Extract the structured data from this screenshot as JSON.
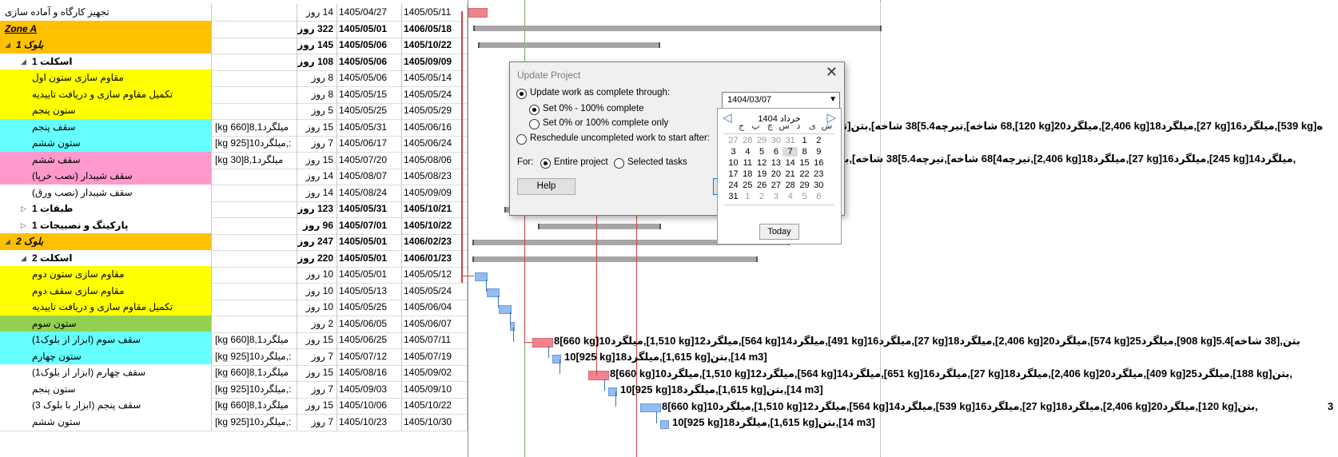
{
  "rows": [
    {
      "name": "تجهیز کارگاه و آماده سازی",
      "res": "",
      "dur": "14 روز",
      "start": "1405/04/27",
      "finish": "1405/05/11",
      "bg": "#ffffff",
      "bold": false,
      "italic": false,
      "indent": 0,
      "tri": ""
    },
    {
      "name": "Zone A",
      "res": "",
      "dur": "322 روز",
      "start": "1405/05/01",
      "finish": "1406/05/18",
      "bg": "#ffc000",
      "bold": true,
      "italic": true,
      "indent": 0,
      "tri": "",
      "ltr": true
    },
    {
      "name": "بلوک 1",
      "res": "",
      "dur": "145 روز",
      "start": "1405/05/06",
      "finish": "1405/10/22",
      "bg": "#ffc000",
      "bold": true,
      "italic": true,
      "indent": 1,
      "tri": "◢"
    },
    {
      "name": "اسکلت 1",
      "res": "",
      "dur": "108 روز",
      "start": "1405/05/06",
      "finish": "1405/09/09",
      "bg": "#ffffff",
      "bold": true,
      "italic": false,
      "indent": 2,
      "tri": "◢"
    },
    {
      "name": "مقاوم سازی ستون اول",
      "res": "",
      "dur": "8 روز",
      "start": "1405/05/06",
      "finish": "1405/05/14",
      "bg": "#ffff00",
      "bold": false,
      "italic": false,
      "indent": 3,
      "tri": ""
    },
    {
      "name": "تکمیل مقاوم سازی و دریافت تاییدیه",
      "res": "",
      "dur": "8 روز",
      "start": "1405/05/15",
      "finish": "1405/05/24",
      "bg": "#ffff00",
      "bold": false,
      "italic": false,
      "indent": 3,
      "tri": ""
    },
    {
      "name": "ستون پنجم",
      "res": "",
      "dur": "5 روز",
      "start": "1405/05/25",
      "finish": "1405/05/29",
      "bg": "#ffff00",
      "bold": false,
      "italic": false,
      "indent": 3,
      "tri": ""
    },
    {
      "name": "سقف پنجم",
      "res": "[kg 660]میلگرد8,1",
      "dur": "15 روز",
      "start": "1405/05/31",
      "finish": "1405/06/16",
      "bg": "#66ffff",
      "bold": false,
      "italic": false,
      "indent": 3,
      "tri": ""
    },
    {
      "name": "ستون ششم",
      "res": "[kg 925]میلگرد10,:",
      "dur": "7 روز",
      "start": "1405/06/17",
      "finish": "1405/06/24",
      "bg": "#66ffff",
      "bold": false,
      "italic": false,
      "indent": 3,
      "tri": ""
    },
    {
      "name": "سقف ششم",
      "res": "[kg 30]میلگرد8,1",
      "dur": "15 روز",
      "start": "1405/07/20",
      "finish": "1405/08/06",
      "bg": "#ff99cc",
      "bold": false,
      "italic": false,
      "indent": 3,
      "tri": ""
    },
    {
      "name": "سقف شیبدار (نصب خرپا)",
      "res": "",
      "dur": "14 روز",
      "start": "1405/08/07",
      "finish": "1405/08/23",
      "bg": "#ff99cc",
      "bold": false,
      "italic": false,
      "indent": 3,
      "tri": ""
    },
    {
      "name": "سقف شیبدار (نصب ورق)",
      "res": "",
      "dur": "14 روز",
      "start": "1405/08/24",
      "finish": "1405/09/09",
      "bg": "#ffffff",
      "bold": false,
      "italic": false,
      "indent": 3,
      "tri": ""
    },
    {
      "name": "طبقات 1",
      "res": "",
      "dur": "123 روز",
      "start": "1405/05/31",
      "finish": "1405/10/21",
      "bg": "#ffffff",
      "bold": true,
      "italic": false,
      "indent": 2,
      "tri": "▷"
    },
    {
      "name": "پارکینگ و نصبیجات 1",
      "res": "",
      "dur": "96 روز",
      "start": "1405/07/01",
      "finish": "1405/10/22",
      "bg": "#ffffff",
      "bold": true,
      "italic": false,
      "indent": 2,
      "tri": "▷"
    },
    {
      "name": "بلوک 2",
      "res": "",
      "dur": "247 روز",
      "start": "1405/05/01",
      "finish": "1406/02/23",
      "bg": "#ffc000",
      "bold": true,
      "italic": true,
      "indent": 1,
      "tri": "◢"
    },
    {
      "name": "اسکلت 2",
      "res": "",
      "dur": "220 روز",
      "start": "1405/05/01",
      "finish": "1406/01/23",
      "bg": "#ffffff",
      "bold": true,
      "italic": false,
      "indent": 2,
      "tri": "◢"
    },
    {
      "name": "مقاوم سازی ستون دوم",
      "res": "",
      "dur": "10 روز",
      "start": "1405/05/01",
      "finish": "1405/05/12",
      "bg": "#ffff00",
      "bold": false,
      "italic": false,
      "indent": 3,
      "tri": ""
    },
    {
      "name": "مقاوم سازی سقف دوم",
      "res": "",
      "dur": "10 روز",
      "start": "1405/05/13",
      "finish": "1405/05/24",
      "bg": "#ffff00",
      "bold": false,
      "italic": false,
      "indent": 3,
      "tri": ""
    },
    {
      "name": "تکمیل مقاوم سازی و دریافت تاییدیه",
      "res": "",
      "dur": "10 روز",
      "start": "1405/05/25",
      "finish": "1405/06/04",
      "bg": "#ffff00",
      "bold": false,
      "italic": false,
      "indent": 3,
      "tri": ""
    },
    {
      "name": "ستون سوم",
      "res": "",
      "dur": "2 روز",
      "start": "1405/06/05",
      "finish": "1405/06/07",
      "bg": "#92d050",
      "bold": false,
      "italic": false,
      "indent": 3,
      "tri": ""
    },
    {
      "name": "سقف سوم (ابزار از بلوک1)",
      "res": "[kg 660]میلگرد8,1",
      "dur": "15 روز",
      "start": "1405/06/25",
      "finish": "1405/07/11",
      "bg": "#66ffff",
      "bold": false,
      "italic": false,
      "indent": 3,
      "tri": ""
    },
    {
      "name": "ستون چهارم",
      "res": "[kg 925]میلگرد10,:",
      "dur": "7 روز",
      "start": "1405/07/12",
      "finish": "1405/07/19",
      "bg": "#66ffff",
      "bold": false,
      "italic": false,
      "indent": 3,
      "tri": ""
    },
    {
      "name": "سقف چهارم (ابزار از بلوک1)",
      "res": "[kg 660]میلگرد8,1",
      "dur": "15 روز",
      "start": "1405/08/16",
      "finish": "1405/09/02",
      "bg": "#ffffff",
      "bold": false,
      "italic": false,
      "indent": 3,
      "tri": ""
    },
    {
      "name": "ستون پنجم",
      "res": "[kg 925]میلگرد10,:",
      "dur": "7 روز",
      "start": "1405/09/03",
      "finish": "1405/09/10",
      "bg": "#ffffff",
      "bold": false,
      "italic": false,
      "indent": 3,
      "tri": ""
    },
    {
      "name": "سقف پنجم (ابزار با بلوک 3)",
      "res": "[kg 660]میلگرد8,1",
      "dur": "15 روز",
      "start": "1405/10/06",
      "finish": "1405/10/22",
      "bg": "#ffffff",
      "bold": false,
      "italic": false,
      "indent": 3,
      "tri": ""
    },
    {
      "name": "ستون ششم",
      "res": "[kg 925]میلگرد10,:",
      "dur": "7 روز",
      "start": "1405/10/23",
      "finish": "1405/10/30",
      "bg": "#ffffff",
      "bold": false,
      "italic": false,
      "indent": 3,
      "tri": ""
    }
  ],
  "gantt_labels": {
    "l7": "70 [تیرچه4]68 شاخه],تیرچه5.4]38 شاخه],بتن,[120 kg]میلگرد20,[2,406 kg]میلگرد18,[27 kg]میلگرد16,[539 kg]ه",
    "l9": "[35 m3]تیرچه4]68 شاخه],تیرچه5.4]38 شاخه],بتن,[2,406 kg]میلگرد18,[27 kg]میلگرد16,[245 kg]میلگرد14,",
    "l20a": "8[660 kg]میلگرد10,[1,510 kg]میلگرد12,[564 kg]میلگرد14,[491 kg]میلگرد16,[27 kg]میلگرد18,[2,406 kg]میلگرد20,[574 kg]میلگرد25,[908 kg]بتن,[38 شاخه]5.4",
    "l21": "10[925 kg]میلگرد18,[1,615 kg]بتن,[14 m3]",
    "l22": "8[660 kg]میلگرد10,[1,510 kg]میلگرد12,[564 kg]میلگرد14,[651 kg]میلگرد16,[27 kg]میلگرد18,[2,406 kg]میلگرد20,[409 kg]میلگرد25,[188 kg]بتن,",
    "l23": "10[925 kg]میلگرد18,[1,615 kg]بتن,[14 m3]",
    "l24": "8[660 kg]میلگرد10,[1,510 kg]میلگرد12,[564 kg]میلگرد14,[539 kg]میلگرد16,[27 kg]میلگرد18,[2,406 kg]میلگرد20,[120 kg]بتن,",
    "l24b": "3",
    "l25": "10[925 kg]میلگرد18,[1,615 kg]بتن,[14 m3]"
  },
  "dialog": {
    "title": "Update Project",
    "close": "✕",
    "opt1": "Update work as complete through:",
    "sub1": "Set 0% - 100% complete",
    "sub2": "Set 0% or 100% complete only",
    "opt2": "Reschedule uncompleted work to start after:",
    "for_label": "For:",
    "for1": "Entire project",
    "for2": "Selected tasks",
    "help": "Help",
    "date": "1404/03/07"
  },
  "calendar": {
    "header": "خرداد 1404",
    "dow": [
      "ش",
      "ی",
      "د",
      "س",
      "چ",
      "پ",
      "ج"
    ],
    "weeks": [
      [
        {
          "d": "27",
          "g": true
        },
        {
          "d": "28",
          "g": true
        },
        {
          "d": "29",
          "g": true
        },
        {
          "d": "30",
          "g": true
        },
        {
          "d": "31",
          "g": true
        },
        {
          "d": "1"
        },
        {
          "d": "2"
        }
      ],
      [
        {
          "d": "3"
        },
        {
          "d": "4"
        },
        {
          "d": "5"
        },
        {
          "d": "6"
        },
        {
          "d": "7"
        },
        {
          "d": "8"
        },
        {
          "d": "9"
        }
      ],
      [
        {
          "d": "10"
        },
        {
          "d": "11"
        },
        {
          "d": "12"
        },
        {
          "d": "13"
        },
        {
          "d": "14"
        },
        {
          "d": "15"
        },
        {
          "d": "16"
        }
      ],
      [
        {
          "d": "17"
        },
        {
          "d": "18"
        },
        {
          "d": "19"
        },
        {
          "d": "20"
        },
        {
          "d": "21"
        },
        {
          "d": "22"
        },
        {
          "d": "23"
        }
      ],
      [
        {
          "d": "24"
        },
        {
          "d": "25"
        },
        {
          "d": "26"
        },
        {
          "d": "27"
        },
        {
          "d": "28"
        },
        {
          "d": "29"
        },
        {
          "d": "30"
        }
      ],
      [
        {
          "d": "31"
        },
        {
          "d": "1",
          "g": true
        },
        {
          "d": "2",
          "g": true
        },
        {
          "d": "3",
          "g": true
        },
        {
          "d": "4",
          "g": true
        },
        {
          "d": "5",
          "g": true
        },
        {
          "d": "6",
          "g": true
        }
      ]
    ],
    "today": "Today"
  }
}
